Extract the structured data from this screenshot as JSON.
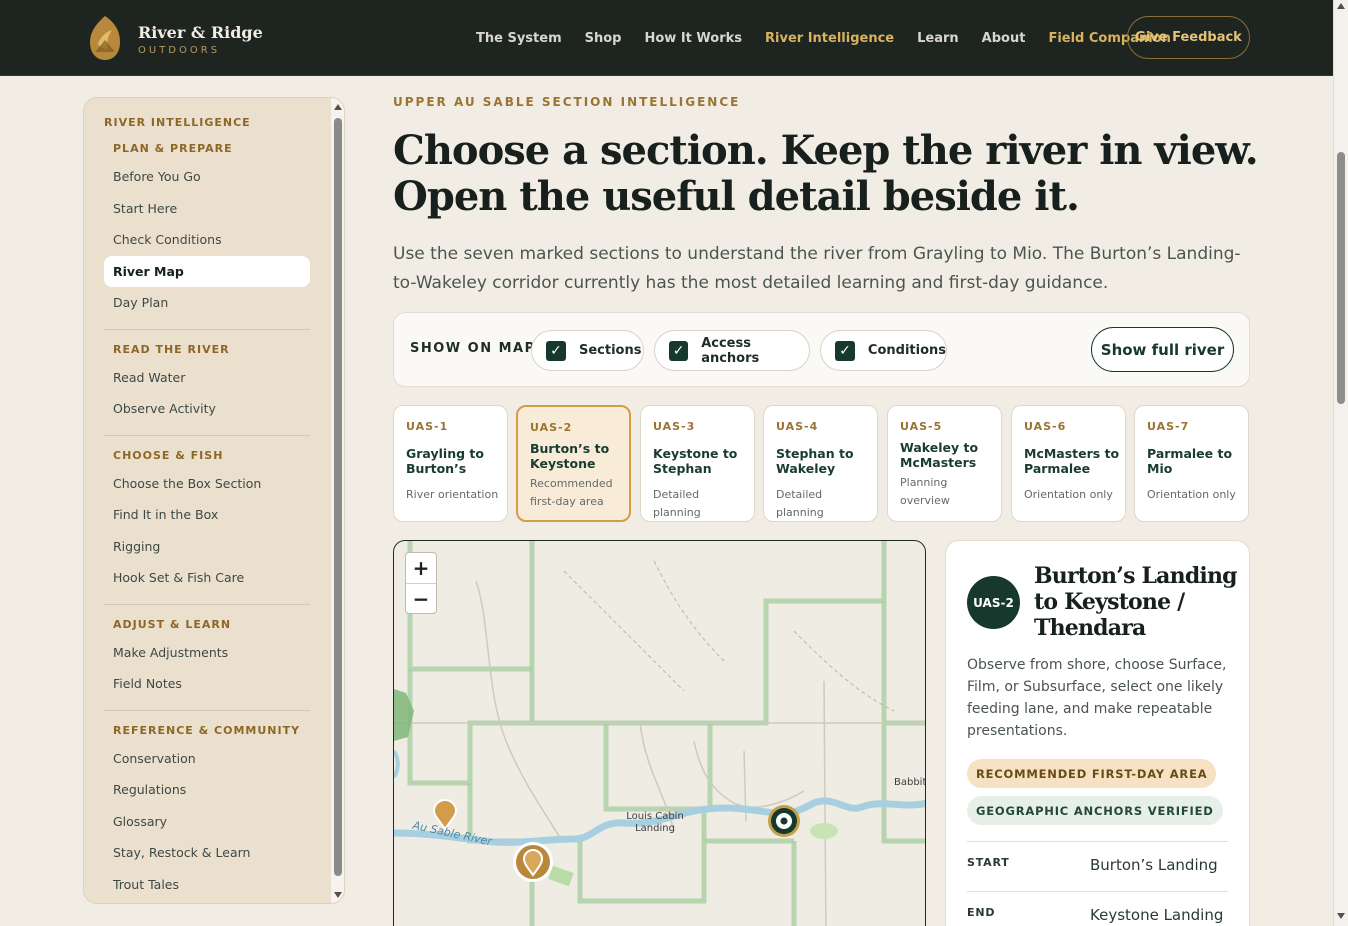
{
  "header": {
    "brand_name": "River & Ridge",
    "brand_sub": "OUTDOORS",
    "nav": [
      "The System",
      "Shop",
      "How It Works",
      "River Intelligence",
      "Learn",
      "About",
      "Field Companion"
    ],
    "feedback_label": "Give Feedback"
  },
  "sidebar": {
    "title": "RIVER INTELLIGENCE",
    "groups": [
      {
        "heading": "PLAN & PREPARE",
        "items": [
          "Before You Go",
          "Start Here",
          "Check Conditions",
          "River Map",
          "Day Plan"
        ]
      },
      {
        "heading": "READ THE RIVER",
        "items": [
          "Read Water",
          "Observe Activity"
        ]
      },
      {
        "heading": "CHOOSE & FISH",
        "items": [
          "Choose the Box Section",
          "Find It in the Box",
          "Rigging",
          "Hook Set & Fish Care"
        ]
      },
      {
        "heading": "ADJUST & LEARN",
        "items": [
          "Make Adjustments",
          "Field Notes"
        ]
      },
      {
        "heading": "REFERENCE & COMMUNITY",
        "items": [
          "Conservation",
          "Regulations",
          "Glossary",
          "Stay, Restock & Learn",
          "Trout Tales"
        ]
      }
    ],
    "active_item": "River Map"
  },
  "main": {
    "eyebrow": "UPPER AU SABLE SECTION INTELLIGENCE",
    "headline": "Choose a section. Keep the river in view. Open the useful detail beside it.",
    "intro": "Use the seven marked sections to understand the river from Grayling to Mio. The Burton’s Landing-to-Wakeley corridor currently has the most detailed learning and first-day guidance."
  },
  "filters": {
    "label": "SHOW ON MAP",
    "chips": [
      {
        "label": "Sections",
        "checked": true
      },
      {
        "label": "Access anchors",
        "checked": true
      },
      {
        "label": "Conditions",
        "checked": true
      }
    ],
    "full_river_label": "Show full river"
  },
  "sections": [
    {
      "code": "UAS-1",
      "name": "Grayling to Burton’s",
      "sub": "River orientation",
      "active": false
    },
    {
      "code": "UAS-2",
      "name": "Burton’s to Keystone",
      "sub": "Recommended first-day area",
      "active": true
    },
    {
      "code": "UAS-3",
      "name": "Keystone to Stephan",
      "sub": "Detailed planning",
      "active": false
    },
    {
      "code": "UAS-4",
      "name": "Stephan to Wakeley",
      "sub": "Detailed planning",
      "active": false
    },
    {
      "code": "UAS-5",
      "name": "Wakeley to McMasters",
      "sub": "Planning overview",
      "active": false
    },
    {
      "code": "UAS-6",
      "name": "McMasters to Parmalee",
      "sub": "Orientation only",
      "active": false
    },
    {
      "code": "UAS-7",
      "name": "Parmalee to Mio",
      "sub": "Orientation only",
      "active": false
    }
  ],
  "map": {
    "zoom_in": "+",
    "zoom_out": "−",
    "labels": {
      "river": "Au Sable River",
      "landing": "Louis Cabin Landing",
      "babbitt": "Babbit"
    }
  },
  "detail": {
    "badge": "UAS-2",
    "title": "Burton’s Landing to Keystone / Thendara",
    "description": "Observe from shore, choose Surface, Film, or Subsurface, select one likely feeding lane, and make repeatable presentations.",
    "pills": [
      "RECOMMENDED FIRST-DAY AREA",
      "GEOGRAPHIC ANCHORS VERIFIED"
    ],
    "rows": [
      {
        "key": "START",
        "value": "Burton’s Landing"
      },
      {
        "key": "END",
        "value": "Keystone Landing"
      }
    ]
  },
  "colors": {
    "brand_dark": "#1e2420",
    "accent_gold": "#d8b25e",
    "primary_green": "#16382d",
    "page_bg": "#f2ede4"
  }
}
